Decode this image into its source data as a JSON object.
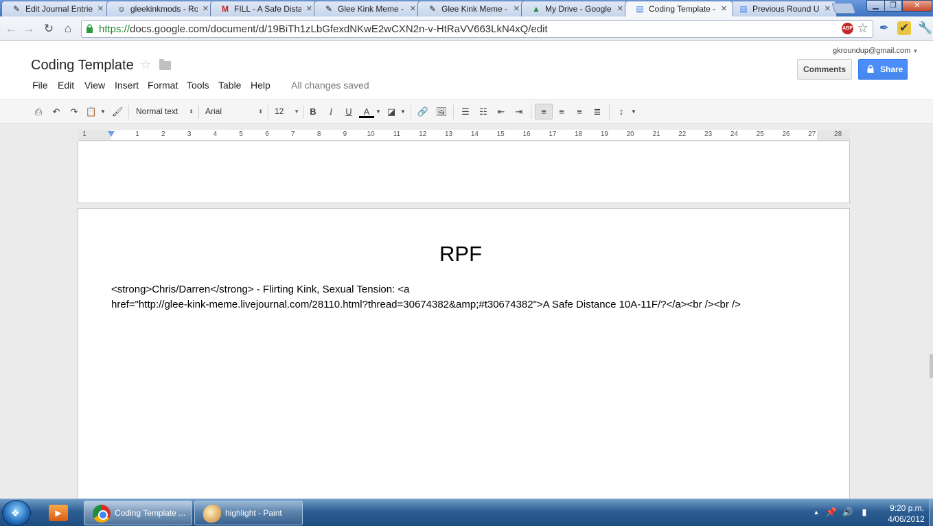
{
  "browser": {
    "tabs": [
      {
        "label": "Edit Journal Entries",
        "icon": "pencil-icon",
        "glyph": "✎"
      },
      {
        "label": "gleekinkmods - Ro",
        "icon": "user-icon",
        "glyph": "☺"
      },
      {
        "label": "FILL - A Safe Distan",
        "icon": "gmail-icon",
        "glyph": "M"
      },
      {
        "label": "Glee Kink Meme - F",
        "icon": "pencil-icon",
        "glyph": "✎"
      },
      {
        "label": "Glee Kink Meme - F",
        "icon": "pencil-icon",
        "glyph": "✎"
      },
      {
        "label": "My Drive - Google I",
        "icon": "drive-icon",
        "glyph": "▲"
      },
      {
        "label": "Coding Template -",
        "icon": "docs-icon",
        "glyph": "▤"
      },
      {
        "label": "Previous Round Up",
        "icon": "docs-icon",
        "glyph": "▤"
      }
    ],
    "url_protocol": "https://",
    "url_rest": "docs.google.com/document/d/19BiTh1zLbGfexdNKwE2wCXN2n-v-HtRaVV663LkN4xQ/edit",
    "abp_label": "ABP"
  },
  "docs": {
    "title": "Coding Template",
    "account": "gkroundup@gmail.com",
    "comments_label": "Comments",
    "share_label": "Share",
    "menu": [
      "File",
      "Edit",
      "View",
      "Insert",
      "Format",
      "Tools",
      "Table",
      "Help"
    ],
    "save_status": "All changes saved",
    "style_value": "Normal text",
    "font_value": "Arial",
    "size_value": "12",
    "bold_glyph": "B",
    "italic_glyph": "I",
    "underline_glyph": "U",
    "textcolor_glyph": "A",
    "ruler_numbers": [
      "1",
      "1",
      "2",
      "3",
      "4",
      "5",
      "6",
      "7",
      "8",
      "9",
      "10",
      "11",
      "12",
      "13",
      "14",
      "15",
      "16",
      "17",
      "18",
      "19",
      "20",
      "21",
      "22",
      "23",
      "24",
      "25",
      "26",
      "27",
      "28"
    ]
  },
  "document": {
    "heading": "RPF",
    "body_line1": "<strong>Chris/Darren</strong> - Flirting Kink, Sexual Tension: <a",
    "body_line2": "href=\"http://glee-kink-meme.livejournal.com/28110.html?thread=30674382&amp;#t30674382\">A Safe Distance 10A-11F/?</a><br /><br />"
  },
  "taskbar": {
    "tasks": [
      {
        "label": "Coding Template ..."
      },
      {
        "label": "highlight - Paint"
      }
    ],
    "clock_time": "9:20 p.m.",
    "clock_date": "4/06/2012"
  },
  "colors": {
    "accent": "#4d90fe",
    "url_green": "#1d8a2b"
  }
}
